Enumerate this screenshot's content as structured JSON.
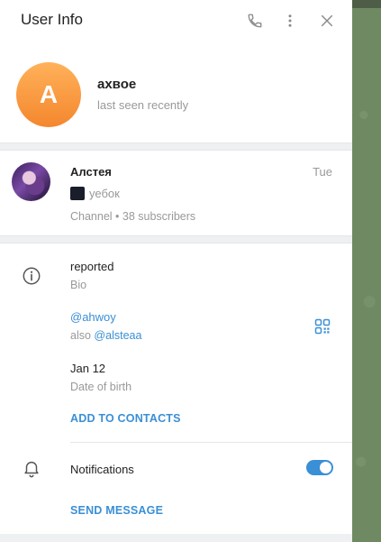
{
  "header": {
    "title": "User Info",
    "call_icon": "phone-icon",
    "more_icon": "more-vertical-icon",
    "close_icon": "close-icon"
  },
  "profile": {
    "avatar_letter": "A",
    "name": "ахвое",
    "status": "last seen recently"
  },
  "channel": {
    "name": "Алстея",
    "date": "Tue",
    "last_message": "уебок",
    "meta": "Channel • 38 subscribers"
  },
  "info": {
    "bio_text": "reported",
    "bio_label": "Bio",
    "username": "@ahwoy",
    "also_prefix": "also",
    "also_username": "@alsteaa",
    "birthday": "Jan 12",
    "birthday_label": "Date of birth",
    "add_contacts": "ADD TO CONTACTS",
    "notifications": "Notifications",
    "notifications_on": true,
    "send_message": "SEND MESSAGE"
  },
  "colors": {
    "accent": "#3a8fd6",
    "avatar_top": "#ffb15a",
    "avatar_bottom": "#f4872e"
  }
}
